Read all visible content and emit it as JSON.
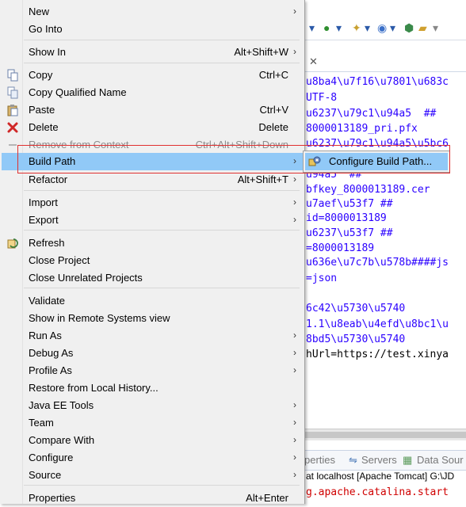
{
  "menu": {
    "items": [
      {
        "label": "New",
        "shortcut": "",
        "submenu": true,
        "icon": ""
      },
      {
        "label": "Go Into",
        "shortcut": "",
        "submenu": false,
        "icon": ""
      },
      {
        "label": "Show In",
        "shortcut": "Alt+Shift+W",
        "submenu": true,
        "icon": ""
      },
      {
        "label": "Copy",
        "shortcut": "Ctrl+C",
        "submenu": false,
        "icon": "copy-icon"
      },
      {
        "label": "Copy Qualified Name",
        "shortcut": "",
        "submenu": false,
        "icon": "copy-qualified-icon"
      },
      {
        "label": "Paste",
        "shortcut": "Ctrl+V",
        "submenu": false,
        "icon": "paste-icon"
      },
      {
        "label": "Delete",
        "shortcut": "Delete",
        "submenu": false,
        "icon": "delete-icon"
      },
      {
        "label": "Remove from Context",
        "shortcut": "Ctrl+Alt+Shift+Down",
        "submenu": false,
        "icon": "remove-context-icon",
        "disabled": true
      },
      {
        "label": "Build Path",
        "shortcut": "",
        "submenu": true,
        "icon": "",
        "highlighted": true
      },
      {
        "label": "Refactor",
        "shortcut": "Alt+Shift+T",
        "submenu": true,
        "icon": ""
      },
      {
        "label": "Import",
        "shortcut": "",
        "submenu": true,
        "icon": ""
      },
      {
        "label": "Export",
        "shortcut": "",
        "submenu": true,
        "icon": ""
      },
      {
        "label": "Refresh",
        "shortcut": "",
        "submenu": false,
        "icon": "refresh-icon"
      },
      {
        "label": "Close Project",
        "shortcut": "",
        "submenu": false,
        "icon": ""
      },
      {
        "label": "Close Unrelated Projects",
        "shortcut": "",
        "submenu": false,
        "icon": ""
      },
      {
        "label": "Validate",
        "shortcut": "",
        "submenu": false,
        "icon": ""
      },
      {
        "label": "Show in Remote Systems view",
        "shortcut": "",
        "submenu": false,
        "icon": ""
      },
      {
        "label": "Run As",
        "shortcut": "",
        "submenu": true,
        "icon": ""
      },
      {
        "label": "Debug As",
        "shortcut": "",
        "submenu": true,
        "icon": ""
      },
      {
        "label": "Profile As",
        "shortcut": "",
        "submenu": true,
        "icon": ""
      },
      {
        "label": "Restore from Local History...",
        "shortcut": "",
        "submenu": false,
        "icon": ""
      },
      {
        "label": "Java EE Tools",
        "shortcut": "",
        "submenu": true,
        "icon": ""
      },
      {
        "label": "Team",
        "shortcut": "",
        "submenu": true,
        "icon": ""
      },
      {
        "label": "Compare With",
        "shortcut": "",
        "submenu": true,
        "icon": ""
      },
      {
        "label": "Configure",
        "shortcut": "",
        "submenu": true,
        "icon": ""
      },
      {
        "label": "Source",
        "shortcut": "",
        "submenu": true,
        "icon": ""
      },
      {
        "label": "Properties",
        "shortcut": "Alt+Enter",
        "submenu": false,
        "icon": ""
      }
    ],
    "submenu_arrow": "›"
  },
  "submenu": {
    "label": "Configure Build Path...",
    "icon": "build-path-icon"
  },
  "editor": {
    "tab_close": "✕",
    "lines": [
      "u8ba4\\u7f16\\u7801\\u683c",
      "UTF-8",
      "u6237\\u79c1\\u94a5  ##",
      "8000013189_pri.pfx",
      "u6237\\u79c1\\u94a5\\u5bc6",
      "u94a5  ##",
      "bfkey_8000013189.cer",
      "u7aef\\u53f7 ##",
      "id=8000013189",
      "u6237\\u53f7 ##",
      "=8000013189",
      "u636e\\u7c7b\\u578b####js",
      "=json",
      "",
      "6c42\\u5730\\u5740",
      "1.1\\u8eab\\u4efd\\u8bc1\\u",
      "8bd5\\u5730\\u5740",
      "hUrl=https://test.xinya"
    ]
  },
  "bottom": {
    "tab_properties": "perties",
    "tab_servers": "Servers",
    "tab_datasource": "Data Sour",
    "console_title": "at localhost [Apache Tomcat] G:\\JD",
    "console_line": "g.apache.catalina.start"
  },
  "colors": {
    "highlight": "#91c9f7",
    "menu_bg": "#f0f0f0",
    "annotation": "#e03030",
    "code_blue": "#2a00ff"
  }
}
